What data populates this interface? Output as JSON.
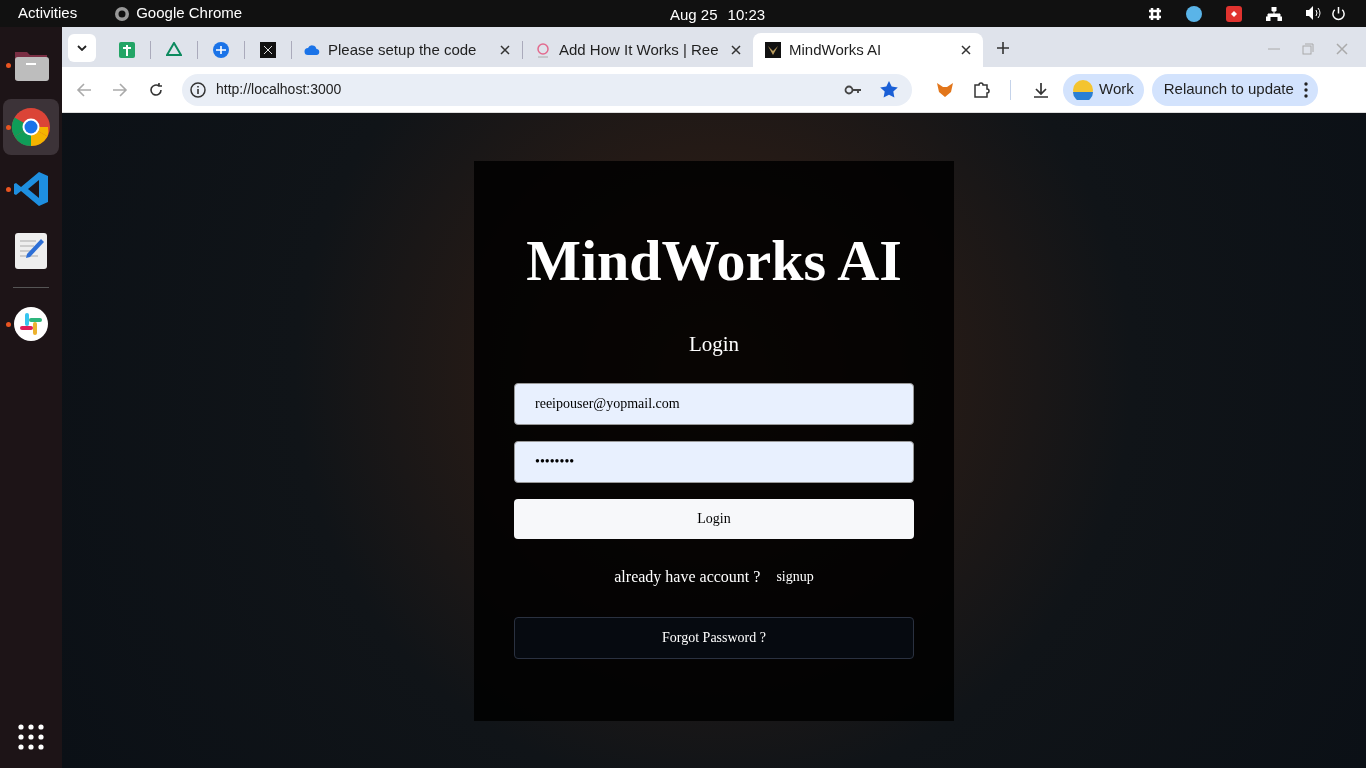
{
  "top_bar": {
    "activities": "Activities",
    "app_name": "Google Chrome",
    "date": "Aug 25",
    "time": "10:23"
  },
  "dock": {
    "apps": [
      {
        "kind": "files",
        "running": true,
        "selected": false
      },
      {
        "kind": "chrome",
        "running": true,
        "selected": true
      },
      {
        "kind": "vscode",
        "running": true,
        "selected": false
      },
      {
        "kind": "editor",
        "running": false,
        "selected": false
      },
      {
        "kind": "slack",
        "running": true,
        "selected": false
      }
    ]
  },
  "browser": {
    "tabs": [
      {
        "kind": "sheets",
        "selected": false
      },
      {
        "kind": "recycle",
        "selected": false
      },
      {
        "kind": "blue",
        "selected": false
      },
      {
        "kind": "dark",
        "selected": false
      },
      {
        "kind": "cloud",
        "title": "Please setup the code",
        "selected": false
      },
      {
        "kind": "pink",
        "title": "Add How It Works | Ree",
        "selected": false
      },
      {
        "kind": "logo",
        "title": "MindWorks AI",
        "selected": true
      }
    ],
    "url": "http://localhost:3000",
    "profile": "Work",
    "relaunch": "Relaunch to update"
  },
  "login": {
    "brand": "MindWorks AI",
    "heading": "Login",
    "email": "reeipouser@yopmail.com",
    "password": "••••••••",
    "submit": "Login",
    "prompt": "already have account ?",
    "signup": "signup",
    "forgot": "Forgot Password ?"
  }
}
